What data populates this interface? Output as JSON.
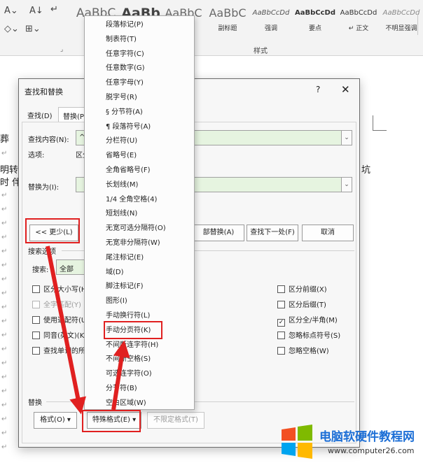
{
  "ribbon": {
    "styles": [
      {
        "preview": "AaBbC",
        "name": ""
      },
      {
        "preview": "AaBb",
        "name": ""
      },
      {
        "preview": "AaBbC",
        "name": ""
      },
      {
        "preview": "AaBbC",
        "name": "副标题"
      },
      {
        "preview": "AaBbCcDd",
        "name": "强调"
      },
      {
        "preview": "AaBbCcDd",
        "name": "要点"
      },
      {
        "preview": "AaBbCcDd",
        "name": "正文"
      },
      {
        "preview": "AaBbCcDd",
        "name": "不明显强调"
      }
    ],
    "group_label": "样式"
  },
  "document": {
    "text_fragments": [
      "葬",
      "明转",
      "时 伴",
      "坑"
    ]
  },
  "dialog": {
    "title": "查找和替换",
    "help": "?",
    "close": "✕",
    "tabs": [
      "查找(D)",
      "替换(P)"
    ],
    "find_label": "查找内容(N):",
    "find_value": "^m",
    "options_label": "选项:",
    "options_value": "区分",
    "replace_label": "替换为(I):",
    "replace_value": "",
    "more_button": "<< 更少(L)",
    "replace_all_button": "部替换(A)",
    "find_next_button": "查找下一处(F)",
    "cancel_button": "取消",
    "search_options_heading": "搜索选项",
    "search_label": "搜索:",
    "search_value": "全部",
    "left_checks": [
      {
        "label": "区分大小写(H)",
        "checked": false,
        "disabled": false
      },
      {
        "label": "全字匹配(Y)",
        "checked": false,
        "disabled": true
      },
      {
        "label": "使用通配符(U)",
        "checked": false,
        "disabled": false
      },
      {
        "label": "同音(英文)(K)",
        "checked": false,
        "disabled": false
      },
      {
        "label": "查找单词的所",
        "checked": false,
        "disabled": false
      }
    ],
    "right_checks": [
      {
        "label": "区分前缀(X)",
        "checked": false
      },
      {
        "label": "区分后缀(T)",
        "checked": false
      },
      {
        "label": "区分全/半角(M)",
        "checked": true
      },
      {
        "label": "忽略标点符号(S)",
        "checked": false
      },
      {
        "label": "忽略空格(W)",
        "checked": false
      }
    ],
    "replace_section_label": "替换",
    "format_button": "格式(O) ▾",
    "special_button": "特殊格式(E) ▾",
    "no_format_button": "不限定格式(T)"
  },
  "special_menu": {
    "items": [
      "段落标记(P)",
      "制表符(T)",
      "任意字符(C)",
      "任意数字(G)",
      "任意字母(Y)",
      "脱字号(R)",
      "§ 分节符(A)",
      "¶ 段落符号(A)",
      "分栏符(U)",
      "省略号(E)",
      "全角省略号(F)",
      "长划线(M)",
      "1/4 全角空格(4)",
      "短划线(N)",
      "无宽可选分隔符(O)",
      "无宽非分隔符(W)",
      "尾注标记(E)",
      "域(D)",
      "脚注标记(F)",
      "图形(I)",
      "手动换行符(L)",
      "手动分页符(K)",
      "不间断连字符(H)",
      "不间断空格(S)",
      "可选连字符(O)",
      "分节符(B)",
      "空白区域(W)"
    ]
  },
  "watermark": {
    "title": "电脑软硬件教程网",
    "url": "www.computer26.com"
  },
  "colors": {
    "annotation_red": "#e02020",
    "field_green": "#e6f4e0",
    "watermark_blue": "#1d6fd6"
  }
}
